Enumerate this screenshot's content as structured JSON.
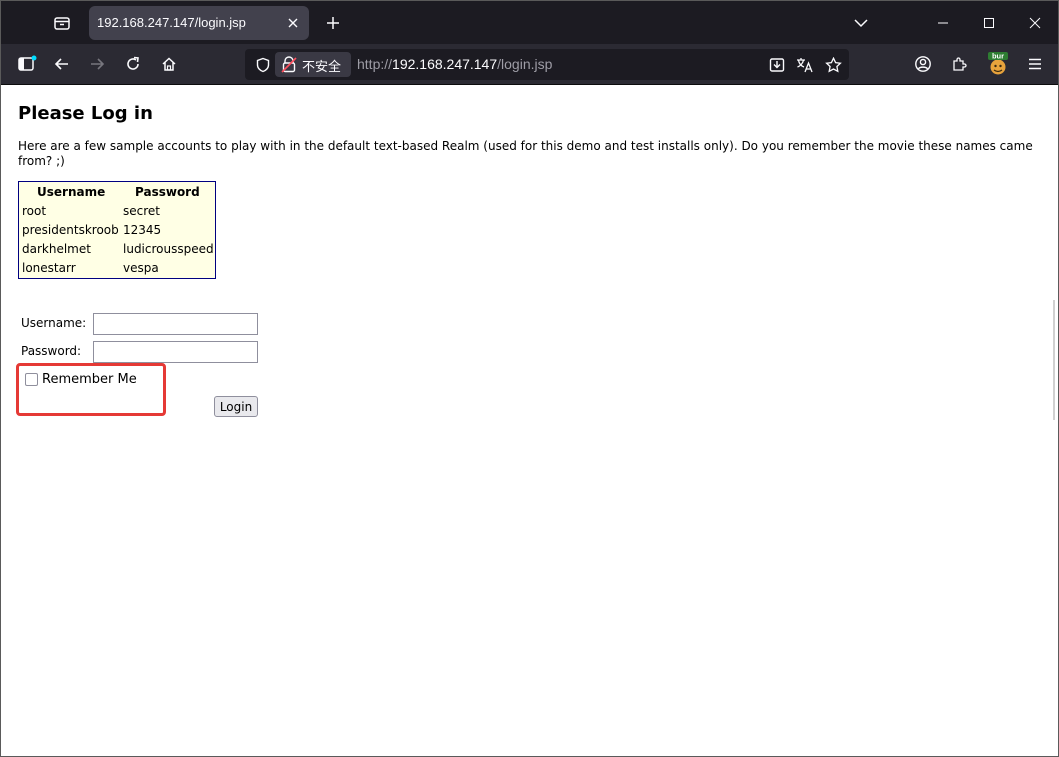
{
  "browser": {
    "tab": {
      "title": "192.168.247.147/login.jsp"
    },
    "urlbar": {
      "security_label": "不安全",
      "url_scheme": "http://",
      "url_host": "192.168.247.147",
      "url_path": "/login.jsp"
    },
    "extension_badge": "bur",
    "colors": {
      "chrome_dark": "#1c1b22",
      "toolbar": "#2b2a33",
      "tab_active": "#42414d",
      "accent_blue": "#00ddff"
    }
  },
  "page": {
    "title": "Please Log in",
    "intro": "Here are a few sample accounts to play with in the default text-based Realm (used for this demo and test installs only). Do you remember the movie these names came from? ;)",
    "accounts_table": {
      "headers": [
        "Username",
        "Password"
      ],
      "rows": [
        [
          "root",
          "secret"
        ],
        [
          "presidentskroob",
          "12345"
        ],
        [
          "darkhelmet",
          "ludicrousspeed"
        ],
        [
          "lonestarr",
          "vespa"
        ]
      ],
      "colors": {
        "background": "#ffffe5",
        "border": "#000080"
      }
    },
    "form": {
      "username_label": "Username:",
      "username_value": "",
      "password_label": "Password:",
      "password_value": "",
      "remember_label": "Remember Me",
      "remember_checked": false,
      "login_label": "Login"
    },
    "highlight_color": "#e53935"
  }
}
